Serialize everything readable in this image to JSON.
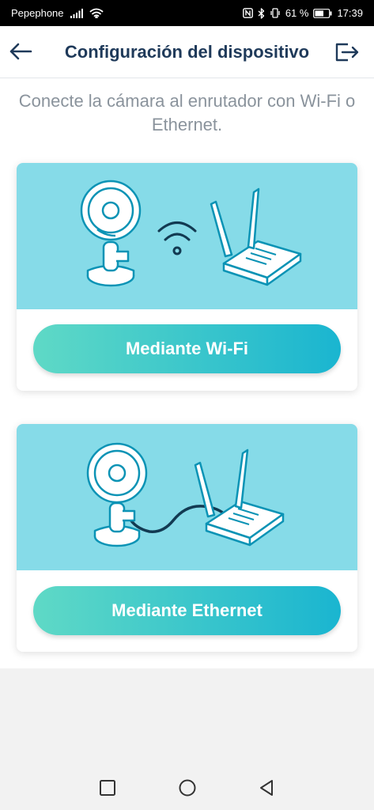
{
  "status_bar": {
    "carrier": "Pepephone",
    "battery": "61 %",
    "time": "17:39"
  },
  "header": {
    "title": "Configuración del dispositivo",
    "back_icon": "arrow-left-icon",
    "exit_icon": "exit-icon"
  },
  "main": {
    "subtitle": "Conecte la cámara al enrutador con Wi-Fi o Ethernet."
  },
  "options": [
    {
      "button_label": "Mediante Wi-Fi",
      "illustration": "camera-wifi-router"
    },
    {
      "button_label": "Mediante Ethernet",
      "illustration": "camera-ethernet-router"
    }
  ],
  "colors": {
    "title": "#1f3a5a",
    "illustration_bg": "#86dbe8",
    "button_gradient_start": "#5fd9c6",
    "button_gradient_end": "#1ab5d0"
  },
  "nav_bar": {
    "icons": [
      "recent-apps-icon",
      "home-icon",
      "back-icon"
    ]
  }
}
